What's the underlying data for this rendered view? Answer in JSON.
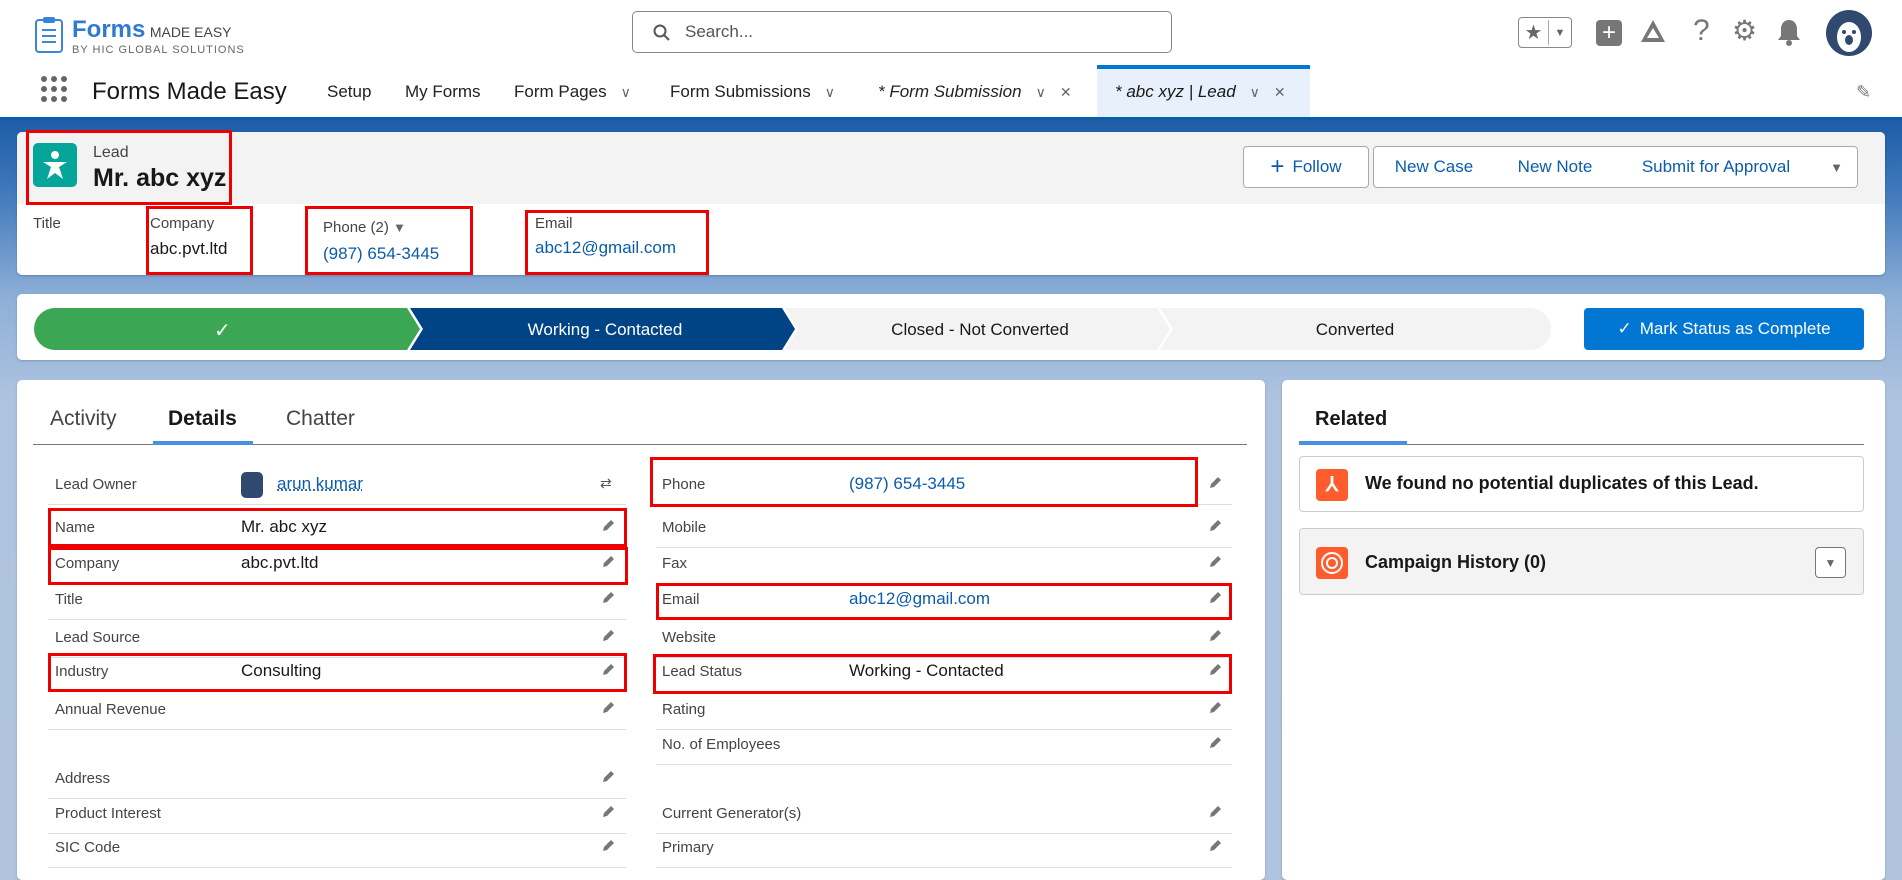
{
  "app": {
    "logo_brand": "Forms",
    "logo_suffix": "MADE EASY",
    "logo_sub": "BY HIC GLOBAL SOLUTIONS",
    "name": "Forms Made Easy"
  },
  "search": {
    "placeholder": "Search..."
  },
  "nav": {
    "items": [
      "Setup",
      "My Forms",
      "Form Pages",
      "Form Submissions"
    ],
    "tabs": [
      {
        "label": "* Form Submission"
      },
      {
        "label": "* abc xyz | Lead"
      }
    ]
  },
  "record": {
    "object": "Lead",
    "name": "Mr. abc xyz",
    "highlights": [
      {
        "label": "Title",
        "value": ""
      },
      {
        "label": "Company",
        "value": "abc.pvt.ltd"
      },
      {
        "label": "Phone (2)",
        "value": "(987) 654-3445"
      },
      {
        "label": "Email",
        "value": "abc12@gmail.com"
      }
    ],
    "actions": {
      "follow": "Follow",
      "new_case": "New Case",
      "new_note": "New Note",
      "submit": "Submit for Approval"
    }
  },
  "path": {
    "stages": [
      "",
      "Working - Contacted",
      "Closed - Not Converted",
      "Converted"
    ],
    "current": 1,
    "mark_complete": "Mark Status as Complete"
  },
  "details": {
    "tabs": [
      "Activity",
      "Details",
      "Chatter"
    ],
    "active_tab": "Details",
    "left": [
      {
        "label": "Lead Owner",
        "value": "arun kumar"
      },
      {
        "label": "Name",
        "value": "Mr. abc xyz"
      },
      {
        "label": "Company",
        "value": "abc.pvt.ltd"
      },
      {
        "label": "Title",
        "value": ""
      },
      {
        "label": "Lead Source",
        "value": ""
      },
      {
        "label": "Industry",
        "value": "Consulting"
      },
      {
        "label": "Annual Revenue",
        "value": ""
      },
      {
        "label": "Address",
        "value": ""
      },
      {
        "label": "Product Interest",
        "value": ""
      },
      {
        "label": "SIC Code",
        "value": ""
      }
    ],
    "right": [
      {
        "label": "Phone",
        "value": "(987) 654-3445"
      },
      {
        "label": "Mobile",
        "value": ""
      },
      {
        "label": "Fax",
        "value": ""
      },
      {
        "label": "Email",
        "value": "abc12@gmail.com"
      },
      {
        "label": "Website",
        "value": ""
      },
      {
        "label": "Lead Status",
        "value": "Working - Contacted"
      },
      {
        "label": "Rating",
        "value": ""
      },
      {
        "label": "No. of Employees",
        "value": ""
      },
      {
        "label": "Current Generator(s)",
        "value": ""
      },
      {
        "label": "Primary",
        "value": ""
      }
    ]
  },
  "related": {
    "title": "Related",
    "duplicates": "We found no potential duplicates of this Lead.",
    "campaign": "Campaign History (0)"
  },
  "colors": {
    "brand": "#0176d3",
    "green": "#3ba755",
    "navy": "#014486",
    "lead_icon": "#06a59a",
    "orange": "#fe5c2c",
    "highlight": "#ee0000"
  }
}
